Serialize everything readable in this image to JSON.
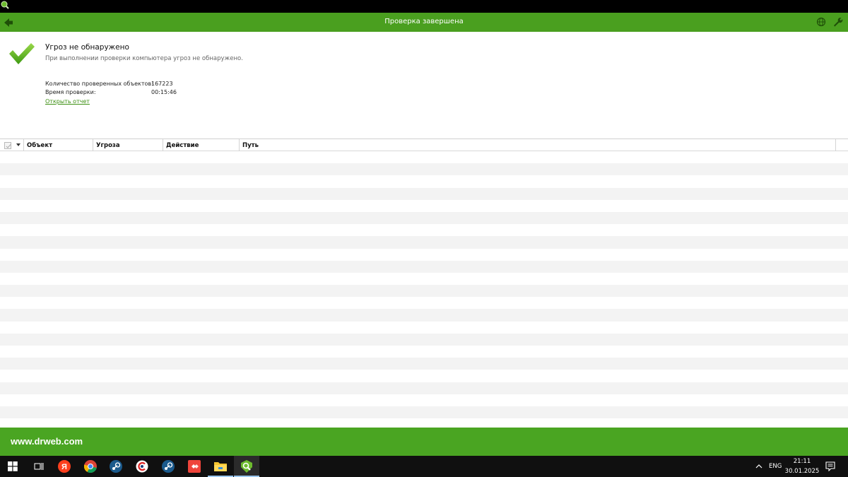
{
  "header": {
    "title": "Проверка завершена"
  },
  "result": {
    "title": "Угроз не обнаружено",
    "description": "При выполнении проверки компьютера угроз не обнаружено.",
    "stats": [
      {
        "label": "Количество проверенных объектов:",
        "value": "167223"
      },
      {
        "label": "Время проверки:",
        "value": "00:15:46"
      }
    ],
    "report_link": "Открыть отчет"
  },
  "table": {
    "columns": [
      "Объект",
      "Угроза",
      "Действие",
      "Путь"
    ],
    "rows": []
  },
  "footer": {
    "url": "www.drweb.com"
  },
  "taskbar": {
    "items": [
      {
        "name": "start-button",
        "icon": "windows-icon"
      },
      {
        "name": "task-view-button",
        "icon": "task-view-icon"
      },
      {
        "name": "yandex-browser",
        "icon": "yandex-icon"
      },
      {
        "name": "chrome",
        "icon": "chrome-icon"
      },
      {
        "name": "steam",
        "icon": "steam-icon"
      },
      {
        "name": "ccleaner",
        "icon": "ccleaner-icon"
      },
      {
        "name": "steam-2",
        "icon": "steam-icon"
      },
      {
        "name": "anydesk",
        "icon": "anydesk-icon"
      },
      {
        "name": "file-explorer",
        "icon": "folder-icon"
      },
      {
        "name": "drweb",
        "icon": "drweb-icon"
      }
    ],
    "tray": {
      "language": "ENG",
      "time": "21:11",
      "date": "30.01.2025"
    }
  },
  "colors": {
    "brand_green": "#4a9f1f",
    "footer_green": "#4aa522",
    "link_green": "#3c8f12"
  }
}
